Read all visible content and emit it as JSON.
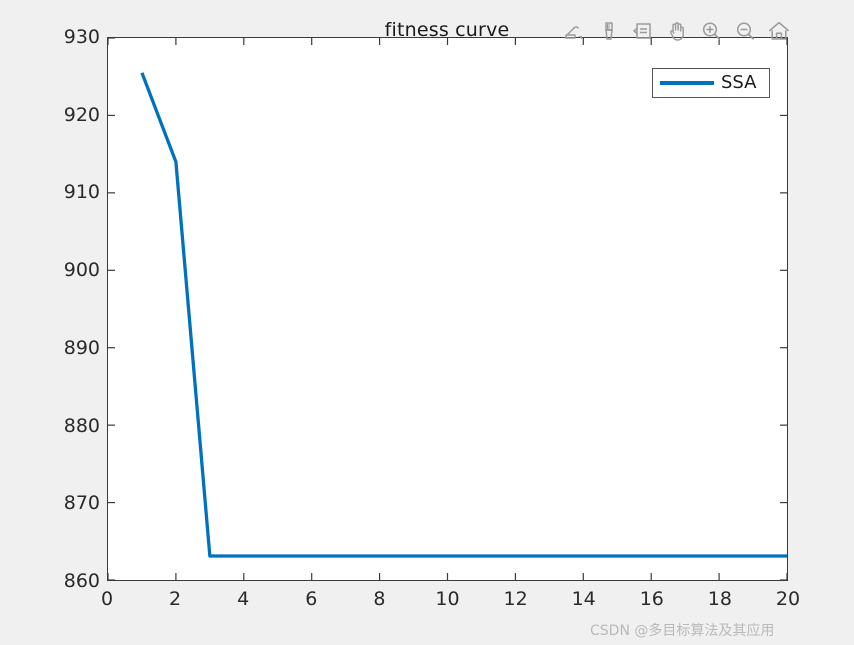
{
  "figure": {
    "background_color": "#f0f0f0",
    "axes_background_color": "#ffffff",
    "axes_border_color": "#3a3a3a"
  },
  "toolbar": {
    "buttons": [
      {
        "name": "link-data-icon",
        "tooltip": "Link Plot"
      },
      {
        "name": "data-brush-icon",
        "tooltip": "Brush/Select Data"
      },
      {
        "name": "data-cursor-icon",
        "tooltip": "Data Cursor"
      },
      {
        "name": "pan-hand-icon",
        "tooltip": "Pan"
      },
      {
        "name": "zoom-in-icon",
        "tooltip": "Zoom In"
      },
      {
        "name": "zoom-out-icon",
        "tooltip": "Zoom Out"
      },
      {
        "name": "home-restore-view-icon",
        "tooltip": "Restore View"
      }
    ]
  },
  "legend": {
    "label": "SSA",
    "line_color": "#0072BD"
  },
  "watermark": {
    "text": "CSDN @多目标算法及其应用"
  },
  "chart_data": {
    "type": "line",
    "title": "fitness curve",
    "xlabel": "",
    "ylabel": "",
    "xlim": [
      0,
      20
    ],
    "ylim": [
      860,
      930
    ],
    "xticks": [
      0,
      2,
      4,
      6,
      8,
      10,
      12,
      14,
      16,
      18,
      20
    ],
    "yticks": [
      860,
      870,
      880,
      890,
      900,
      910,
      920,
      930
    ],
    "grid": false,
    "legend_position": "top-right",
    "line_color": "#0072BD",
    "line_width": 2.6,
    "series": [
      {
        "name": "SSA",
        "x": [
          1,
          2,
          3,
          4,
          5,
          6,
          7,
          8,
          9,
          10,
          11,
          12,
          13,
          14,
          15,
          16,
          17,
          18,
          19,
          20
        ],
        "values": [
          925.5,
          914.0,
          863.1,
          863.1,
          863.1,
          863.1,
          863.1,
          863.1,
          863.1,
          863.1,
          863.1,
          863.1,
          863.1,
          863.1,
          863.1,
          863.1,
          863.1,
          863.1,
          863.1,
          863.1
        ]
      }
    ]
  }
}
